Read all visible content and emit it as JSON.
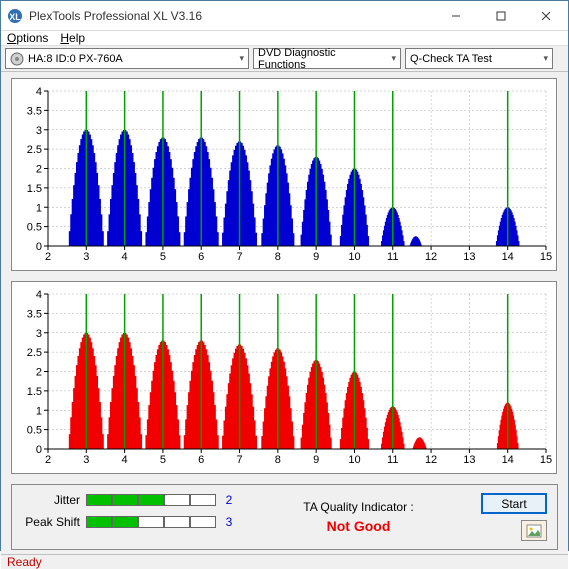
{
  "window": {
    "title": "PlexTools Professional XL V3.16"
  },
  "menu": {
    "options": "Options",
    "help": "Help"
  },
  "toolbar": {
    "drive": "HA:8 ID:0   PX-760A",
    "func": "DVD Diagnostic Functions",
    "test": "Q-Check TA Test"
  },
  "chart_data": [
    {
      "type": "bar",
      "color": "#0000d0",
      "xlabel": "",
      "ylabel": "",
      "xlim": [
        2,
        15
      ],
      "ylim": [
        0,
        4
      ],
      "xticks": [
        2,
        3,
        4,
        5,
        6,
        7,
        8,
        9,
        10,
        11,
        12,
        13,
        14,
        15
      ],
      "yticks": [
        0,
        0.5,
        1,
        1.5,
        2,
        2.5,
        3,
        3.5,
        4
      ],
      "greenlines": [
        3,
        4,
        5,
        6,
        7,
        8,
        9,
        10,
        11,
        14
      ],
      "peaks": [
        {
          "center": 3.0,
          "height": 3.0,
          "width": 0.9
        },
        {
          "center": 4.0,
          "height": 3.0,
          "width": 0.9
        },
        {
          "center": 5.0,
          "height": 2.8,
          "width": 0.9
        },
        {
          "center": 6.0,
          "height": 2.8,
          "width": 0.9
        },
        {
          "center": 7.0,
          "height": 2.7,
          "width": 0.9
        },
        {
          "center": 8.0,
          "height": 2.6,
          "width": 0.85
        },
        {
          "center": 9.0,
          "height": 2.3,
          "width": 0.8
        },
        {
          "center": 10.0,
          "height": 2.0,
          "width": 0.75
        },
        {
          "center": 11.0,
          "height": 1.0,
          "width": 0.6
        },
        {
          "center": 11.6,
          "height": 0.25,
          "width": 0.3
        },
        {
          "center": 14.0,
          "height": 1.0,
          "width": 0.6
        }
      ]
    },
    {
      "type": "bar",
      "color": "#f00000",
      "xlabel": "",
      "ylabel": "",
      "xlim": [
        2,
        15
      ],
      "ylim": [
        0,
        4
      ],
      "xticks": [
        2,
        3,
        4,
        5,
        6,
        7,
        8,
        9,
        10,
        11,
        12,
        13,
        14,
        15
      ],
      "yticks": [
        0,
        0.5,
        1,
        1.5,
        2,
        2.5,
        3,
        3.5,
        4
      ],
      "greenlines": [
        3,
        4,
        5,
        6,
        7,
        8,
        9,
        10,
        11,
        14
      ],
      "peaks": [
        {
          "center": 3.0,
          "height": 3.0,
          "width": 0.9
        },
        {
          "center": 4.0,
          "height": 3.0,
          "width": 0.9
        },
        {
          "center": 5.0,
          "height": 2.8,
          "width": 0.9
        },
        {
          "center": 6.0,
          "height": 2.8,
          "width": 0.9
        },
        {
          "center": 7.0,
          "height": 2.7,
          "width": 0.9
        },
        {
          "center": 8.0,
          "height": 2.6,
          "width": 0.85
        },
        {
          "center": 9.0,
          "height": 2.3,
          "width": 0.8
        },
        {
          "center": 10.0,
          "height": 2.0,
          "width": 0.75
        },
        {
          "center": 11.0,
          "height": 1.1,
          "width": 0.6
        },
        {
          "center": 11.7,
          "height": 0.3,
          "width": 0.35
        },
        {
          "center": 14.0,
          "height": 1.2,
          "width": 0.55
        }
      ]
    }
  ],
  "metrics": {
    "jitter_label": "Jitter",
    "jitter_segments": 3,
    "jitter_total": 5,
    "jitter_value": "2",
    "peakshift_label": "Peak Shift",
    "peakshift_segments": 2,
    "peakshift_total": 5,
    "peakshift_value": "3",
    "taq_label": "TA Quality Indicator :",
    "taq_value": "Not Good"
  },
  "buttons": {
    "start": "Start"
  },
  "status": {
    "text": "Ready"
  }
}
